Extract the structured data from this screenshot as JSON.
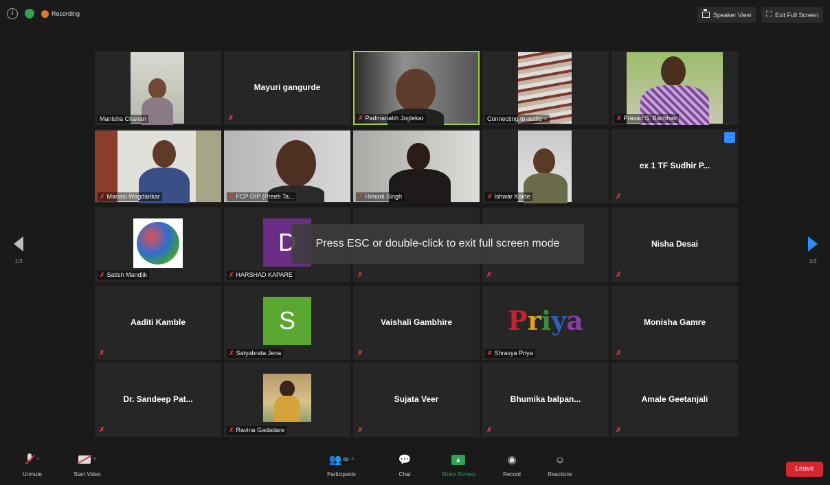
{
  "topbar": {
    "recording_label": "Recording",
    "speaker_view_label": "Speaker View",
    "exit_full_screen_label": "Exit Full Screen"
  },
  "tiles": [
    {
      "name": "Manisha Chavan",
      "type": "video"
    },
    {
      "name": "Mayuri gangurde",
      "type": "name"
    },
    {
      "name": "Padmanabh Joglekar",
      "type": "video",
      "active": true
    },
    {
      "name": "Connecting to audio ~",
      "type": "video"
    },
    {
      "name": "Prasad S. Bachhav",
      "type": "video"
    },
    {
      "name": "Manasi Wagdarikar",
      "type": "video"
    },
    {
      "name": "FCP OIP (Preeti Ta...",
      "type": "video"
    },
    {
      "name": "Himani Singh",
      "type": "video"
    },
    {
      "name": "Ishwar Kalde",
      "type": "video"
    },
    {
      "name": "ex 1 TF Sudhir P...",
      "type": "name"
    },
    {
      "name": "Satish Mandlik",
      "type": "avatar"
    },
    {
      "name": "HARSHAD KAPARE",
      "type": "avatar",
      "initial": "D"
    },
    {
      "name": "",
      "type": "name"
    },
    {
      "name": "",
      "type": "name"
    },
    {
      "name": "Nisha Desai",
      "type": "name"
    },
    {
      "name": "Aaditi Kamble",
      "type": "name"
    },
    {
      "name": "Satyabrata Jena",
      "type": "avatar",
      "initial": "S"
    },
    {
      "name": "Vaishali Gambhire",
      "type": "name"
    },
    {
      "name": "Shravya Priya",
      "type": "avatar",
      "logo": "Priya"
    },
    {
      "name": "Monisha Gamre",
      "type": "name"
    },
    {
      "name": "Dr. Sandeep Pat...",
      "type": "name"
    },
    {
      "name": "Ravina Gadadare",
      "type": "avatar"
    },
    {
      "name": "Sujata Veer",
      "type": "name"
    },
    {
      "name": "Bhumika balpan...",
      "type": "name"
    },
    {
      "name": "Amale Geetanjali",
      "type": "name"
    }
  ],
  "toast": "Press ESC or double-click to exit full screen mode",
  "pager": {
    "left": "1/3",
    "right": "1/3"
  },
  "toolbar": {
    "unmute": "Unmute",
    "start_video": "Start Video",
    "participants": "Participants",
    "participant_count": "69",
    "chat": "Chat",
    "share_screen": "Share Screen",
    "record": "Record",
    "reactions": "Reactions",
    "leave": "Leave"
  },
  "colors": {
    "active_speaker": "#9bd33c",
    "mute": "#e0383e",
    "share": "#2ea44f",
    "leave": "#d6262f",
    "accent": "#2d8cff"
  }
}
